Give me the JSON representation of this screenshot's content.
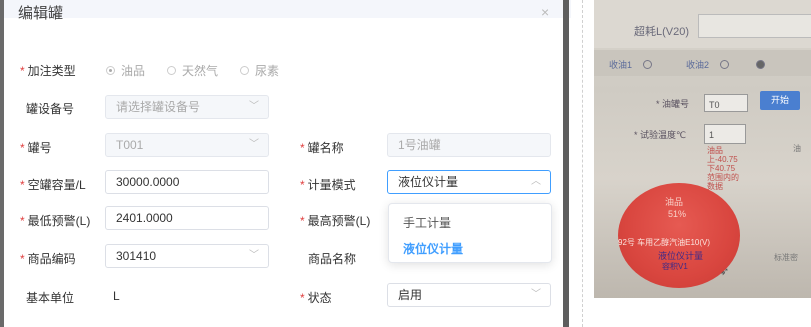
{
  "dialog": {
    "title": "编辑罐",
    "close_icon": "close-icon",
    "fill_type": {
      "label": "加注类型",
      "options": [
        "油品",
        "天然气",
        "尿素"
      ],
      "selected": "油品"
    },
    "tank_device": {
      "label": "罐设备号",
      "placeholder": "请选择罐设备号"
    },
    "tank_no": {
      "label": "罐号",
      "value": "T001"
    },
    "tank_name": {
      "label": "罐名称",
      "value": "1号油罐"
    },
    "empty_capacity": {
      "label": "空罐容量/L",
      "value": "30000.0000"
    },
    "measure_mode": {
      "label": "计量模式",
      "value": "液位仪计量",
      "options": [
        "手工计量",
        "液位仪计量"
      ]
    },
    "min_alarm": {
      "label": "最低预警(L)",
      "value": "2401.0000"
    },
    "max_alarm": {
      "label": "最高预警(L)"
    },
    "product_code": {
      "label": "商品编码",
      "value": "301410"
    },
    "product_name": {
      "label": "商品名称"
    },
    "base_unit": {
      "label": "基本单位",
      "value": "L"
    },
    "status": {
      "label": "状态",
      "value": "启用"
    }
  },
  "photo": {
    "title": "超耗L(V20)",
    "tabs": [
      "收油1",
      "收油2"
    ],
    "oil_gun_label": "油罐号",
    "oil_gun_value": "T0",
    "start_button": "开始",
    "temp_label": "试验温度℃",
    "temp_value": "1",
    "red_notes": [
      "油品",
      "上-40.75",
      "下40.75",
      "范围内的",
      "数据"
    ],
    "circle_lines": [
      "油品",
      "51%",
      "92号 车用乙醇汽油E10(V)",
      "液位仪计量",
      "容积V1"
    ],
    "side_note": "标准密",
    "side_note2": "油"
  },
  "colors": {
    "required": "#e04040",
    "accent": "#409eff",
    "border": "#dcdfe6"
  }
}
